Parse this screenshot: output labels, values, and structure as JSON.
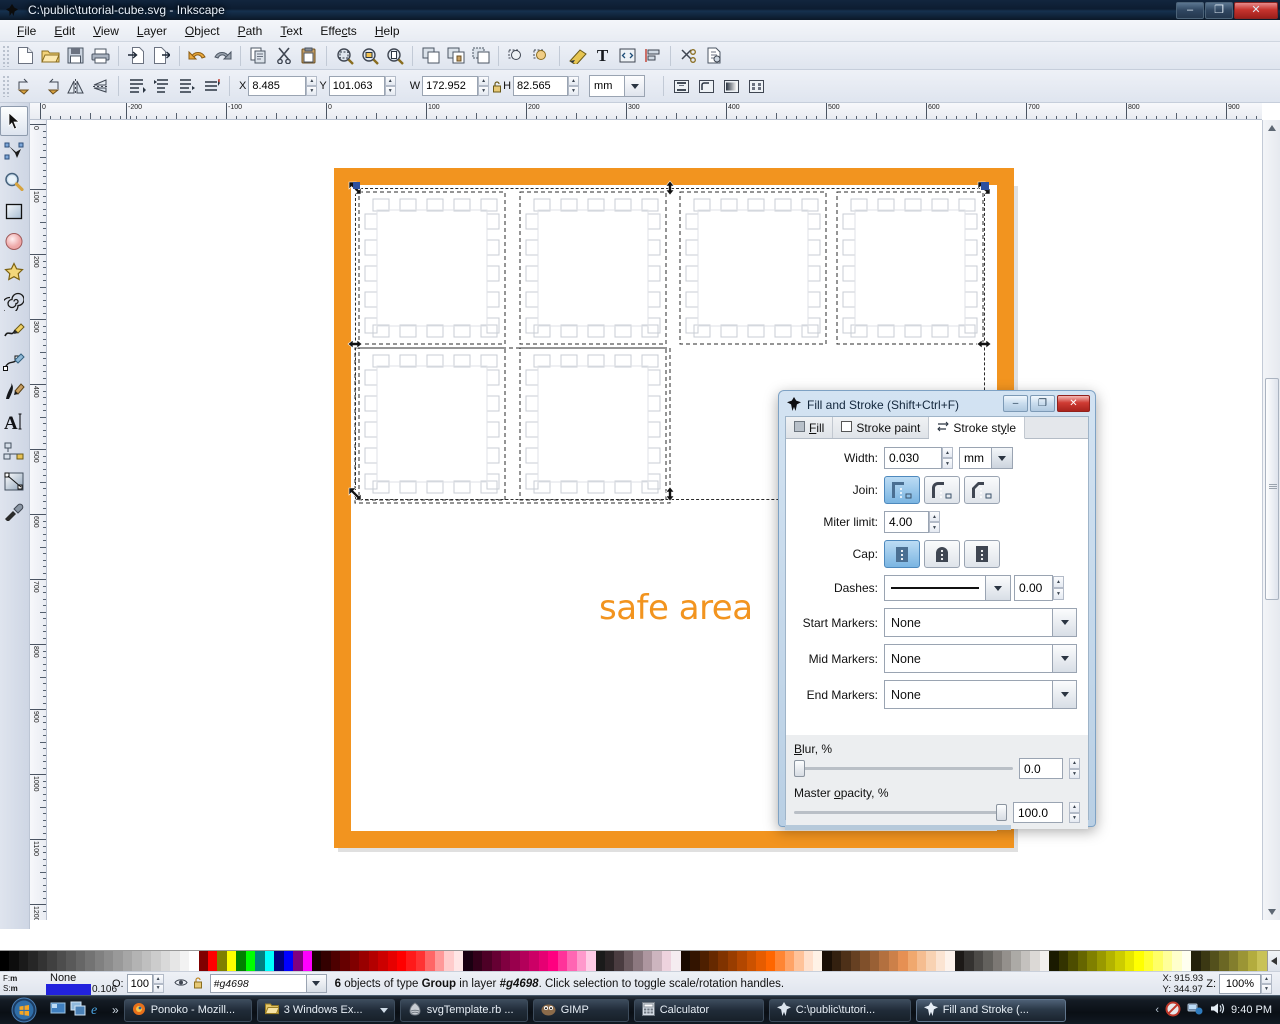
{
  "window": {
    "title": "C:\\public\\tutorial-cube.svg - Inkscape",
    "app_icon": "inkscape-icon",
    "minimize": "–",
    "maximize": "❐",
    "close": "✕"
  },
  "menu": {
    "items": [
      {
        "label": "File"
      },
      {
        "label": "Edit"
      },
      {
        "label": "View"
      },
      {
        "label": "Layer"
      },
      {
        "label": "Object"
      },
      {
        "label": "Path"
      },
      {
        "label": "Text"
      },
      {
        "label": "Effects"
      },
      {
        "label": "Help"
      }
    ]
  },
  "command_bar": {
    "icons": [
      "new-document-icon",
      "open-folder-icon",
      "save-icon",
      "print-icon",
      "import-icon",
      "export-icon",
      "undo-icon",
      "redo-icon",
      "copy-icon",
      "cut-icon",
      "paste-icon",
      "zoom-selection-icon",
      "zoom-drawing-icon",
      "zoom-page-icon",
      "duplicate-icon",
      "group-icon",
      "ungroup-icon",
      "raise-to-top-icon",
      "lower-to-bottom-icon",
      "fill-stroke-icon",
      "text-tool-icon",
      "xml-editor-icon",
      "align-icon",
      "preferences-icon",
      "document-properties-icon"
    ]
  },
  "selector_bar": {
    "icons": [
      "rotate-90-ccw-icon",
      "rotate-90-cw-icon",
      "flip-horizontal-icon",
      "flip-vertical-icon",
      "raise-to-top-icon",
      "raise-icon",
      "lower-icon",
      "lower-to-bottom-icon"
    ],
    "x": {
      "label": "X",
      "value": "8.485"
    },
    "y": {
      "label": "Y",
      "value": "101.063"
    },
    "w": {
      "label": "W",
      "value": "172.952"
    },
    "h": {
      "label": "H",
      "value": "82.565"
    },
    "lock_icon": "lock-ratio-icon",
    "units": {
      "value": "mm",
      "dropdown_icon": "chevron-down-icon"
    },
    "affect_toggles": [
      "scale-stroke-icon",
      "scale-corners-icon",
      "transform-gradient-icon",
      "transform-pattern-icon"
    ]
  },
  "toolbox": {
    "tools": [
      {
        "name": "selector-tool",
        "icon": "arrow-cursor-icon",
        "selected": true
      },
      {
        "name": "node-tool",
        "icon": "node-editor-icon",
        "selected": false
      },
      {
        "name": "zoom-tool",
        "icon": "magnifier-icon",
        "selected": false
      },
      {
        "name": "rectangle-tool",
        "icon": "rectangle-icon",
        "selected": false
      },
      {
        "name": "ellipse-tool",
        "icon": "ellipse-icon",
        "selected": false
      },
      {
        "name": "star-tool",
        "icon": "star-icon",
        "selected": false
      },
      {
        "name": "spiral-tool",
        "icon": "spiral-icon",
        "selected": false
      },
      {
        "name": "pencil-tool",
        "icon": "pencil-icon",
        "selected": false
      },
      {
        "name": "bezier-tool",
        "icon": "bezier-pen-icon",
        "selected": false
      },
      {
        "name": "calligraphy-tool",
        "icon": "calligraphy-pen-icon",
        "selected": false
      },
      {
        "name": "text-tool",
        "icon": "text-a-icon",
        "selected": false
      },
      {
        "name": "connector-tool",
        "icon": "connector-icon",
        "selected": false
      },
      {
        "name": "gradient-tool",
        "icon": "gradient-icon",
        "selected": false
      },
      {
        "name": "dropper-tool",
        "icon": "eyedropper-icon",
        "selected": false
      }
    ]
  },
  "rulers": {
    "horizontal_labels": [
      "0",
      "-200",
      "-100",
      "0",
      "100",
      "200",
      "300",
      "400",
      "500",
      "600",
      "700",
      "800",
      "900"
    ],
    "vertical_labels": [
      "0",
      "100",
      "200",
      "300",
      "400",
      "500",
      "600",
      "700",
      "800",
      "900",
      "1000",
      "1100",
      "1200"
    ]
  },
  "canvas": {
    "safe_area_text": "safe area",
    "safe_area_color": "#f2941f",
    "frame_color": "#f2941f",
    "selection_handles": 8,
    "cube_faces": 6
  },
  "fill_stroke_dialog": {
    "title": "Fill and Stroke (Shift+Ctrl+F)",
    "icon": "inkscape-icon",
    "window_buttons": {
      "minimize": "–",
      "maximize": "❐",
      "close": "✕"
    },
    "tabs": [
      {
        "label": "Fill",
        "icon": "fill-swatch-icon",
        "active": false
      },
      {
        "label": "Stroke paint",
        "icon": "stroke-paint-icon",
        "active": false
      },
      {
        "label": "Stroke style",
        "icon": "stroke-style-icon",
        "active": true
      }
    ],
    "width": {
      "label": "Width:",
      "value": "0.030",
      "unit": "mm",
      "unit_dropdown_icon": "chevron-down-icon"
    },
    "join": {
      "label": "Join:",
      "options": [
        "miter-join-icon",
        "round-join-icon",
        "bevel-join-icon"
      ],
      "selected": 0
    },
    "miter_limit": {
      "label": "Miter limit:",
      "value": "4.00"
    },
    "cap": {
      "label": "Cap:",
      "options": [
        "butt-cap-icon",
        "round-cap-icon",
        "square-cap-icon"
      ],
      "selected": 0
    },
    "dashes": {
      "label": "Dashes:",
      "pattern": "solid-line-icon",
      "offset": "0.00"
    },
    "start_markers": {
      "label": "Start Markers:",
      "value": "None"
    },
    "mid_markers": {
      "label": "Mid Markers:",
      "value": "None"
    },
    "end_markers": {
      "label": "End Markers:",
      "value": "None"
    },
    "blur": {
      "label": "Blur, %",
      "value": "0.0",
      "percent": 0
    },
    "master_opacity": {
      "label": "Master opacity, %",
      "value": "100.0",
      "percent": 100
    }
  },
  "status_bar": {
    "fill_label": "F:",
    "stroke_label": "S:",
    "fill_unit": "m",
    "stroke_unit": "m",
    "fill_value": "None",
    "stroke_width": "0.106",
    "opacity_label": "O:",
    "opacity_value": "100",
    "visibility_icon": "eye-icon",
    "lock_icon": "unlock-icon",
    "layer_value": "#g4698",
    "layer_dropdown_icon": "chevron-down-icon",
    "message_prefix": "6",
    "message_1": " objects of type ",
    "message_bold1": "Group",
    "message_2": " in layer ",
    "message_italic": "#g4698",
    "message_3": ". Click selection to toggle scale/rotation handles.",
    "cursor_x": "X: 915.93",
    "cursor_y": "Y: 344.97",
    "zoom_label": "Z:",
    "zoom_value": "100%"
  },
  "taskbar": {
    "start_icon": "windows-start-orb",
    "quick_launch": [
      "show-desktop-icon",
      "switch-windows-icon",
      "internet-explorer-icon"
    ],
    "quick_launch_more": "»",
    "tasks": [
      {
        "label": "Ponoko - Mozill...",
        "icon": "firefox-icon",
        "active": false
      },
      {
        "label": "3 Windows Ex...",
        "icon": "folder-icon",
        "active": false,
        "has_caret": true
      },
      {
        "label": "svgTemplate.rb ...",
        "icon": "gedit-icon",
        "active": false
      },
      {
        "label": "GIMP",
        "icon": "gimp-icon",
        "active": false
      },
      {
        "label": "Calculator",
        "icon": "calculator-icon",
        "active": false
      },
      {
        "label": "C:\\public\\tutori...",
        "icon": "inkscape-icon",
        "active": false
      },
      {
        "label": "Fill and Stroke (...",
        "icon": "inkscape-icon",
        "active": true
      }
    ],
    "tray": {
      "expand_icon": "chevron-left-icon",
      "icons": [
        "action-center-icon",
        "network-icon",
        "volume-icon"
      ],
      "clock": "9:40 PM"
    }
  },
  "palette": {
    "colors": [
      "#000000",
      "#0d0d0d",
      "#1a1a1a",
      "#262626",
      "#333333",
      "#404040",
      "#4d4d4d",
      "#595959",
      "#666666",
      "#737373",
      "#808080",
      "#8c8c8c",
      "#999999",
      "#a6a6a6",
      "#b3b3b3",
      "#bfbfbf",
      "#cccccc",
      "#d9d9d9",
      "#e6e6e6",
      "#f2f2f2",
      "#ffffff",
      "#800000",
      "#ff0000",
      "#808000",
      "#ffff00",
      "#008000",
      "#00ff00",
      "#008080",
      "#00ffff",
      "#000080",
      "#0000ff",
      "#800080",
      "#ff00ff",
      "#1a0000",
      "#330000",
      "#4d0000",
      "#660000",
      "#800000",
      "#990000",
      "#b30000",
      "#cc0000",
      "#e60000",
      "#ff0000",
      "#ff1a1a",
      "#ff3333",
      "#ff6666",
      "#ff9999",
      "#ffcccc",
      "#ffe6e6",
      "#1a0011",
      "#33001a",
      "#4d0026",
      "#660033",
      "#800040",
      "#99004d",
      "#b3005a",
      "#cc0066",
      "#e60073",
      "#ff0080",
      "#ff339a",
      "#ff66b3",
      "#ff99cc",
      "#ffcce6",
      "#1a1a1a",
      "#2b2426",
      "#4a3c40",
      "#6b5a5f",
      "#8c787f",
      "#ad969f",
      "#cdb5bf",
      "#eed3de",
      "#f5ecf0",
      "#1a0a00",
      "#331400",
      "#4d1f00",
      "#662900",
      "#803300",
      "#993d00",
      "#b34700",
      "#cc5200",
      "#e65c00",
      "#ff6600",
      "#ff8533",
      "#ffa366",
      "#ffc299",
      "#ffe0cc",
      "#fff2e6",
      "#1a0f05",
      "#33200f",
      "#4d3018",
      "#664022",
      "#80502b",
      "#996035",
      "#b3703f",
      "#cc8049",
      "#e69053",
      "#f0a86e",
      "#f5bd90",
      "#f8d2b2",
      "#fbe4d2",
      "#fdf3ec",
      "#1c1917",
      "#343230",
      "#4c4a47",
      "#63615d",
      "#7c7874",
      "#94908c",
      "#acaaa6",
      "#c4c1be",
      "#dcd9d6",
      "#f2f0ee",
      "#1a1a00",
      "#333300",
      "#4d4d00",
      "#666600",
      "#808000",
      "#999900",
      "#b3b300",
      "#cccc00",
      "#e6e600",
      "#ffff00",
      "#ffff33",
      "#ffff66",
      "#ffff99",
      "#ffffcc",
      "#fffff0",
      "#23210b",
      "#3b3813",
      "#53501c",
      "#6b6724",
      "#837e2d",
      "#9b9535",
      "#b3ac3e",
      "#c9c257"
    ]
  }
}
